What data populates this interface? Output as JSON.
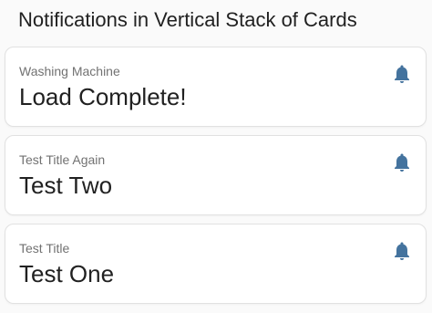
{
  "page": {
    "title": "Notifications in Vertical Stack of Cards"
  },
  "cards": [
    {
      "label": "Washing Machine",
      "value": "Load Complete!",
      "icon": "bell-icon"
    },
    {
      "label": "Test Title Again",
      "value": "Test Two",
      "icon": "bell-icon"
    },
    {
      "label": "Test Title",
      "value": "Test One",
      "icon": "bell-icon"
    }
  ],
  "colors": {
    "icon": "#44739e",
    "background": "#fafafa",
    "card": "#ffffff",
    "label": "#727272",
    "value": "#212121"
  }
}
